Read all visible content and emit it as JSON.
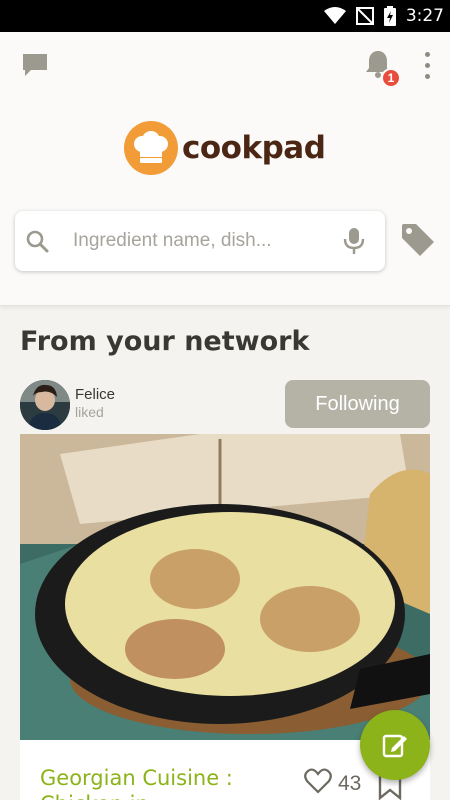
{
  "status_bar": {
    "time": "3:27"
  },
  "header": {
    "notification_count": "1",
    "logo_text": "cookpad",
    "search": {
      "placeholder": "Ingredient name, dish..."
    }
  },
  "feed": {
    "section_title": "From your network",
    "activity": {
      "user_name": "Felice",
      "action": "liked",
      "follow_label": "Following"
    },
    "card": {
      "title_line1": "Georgian Cuisine :",
      "title_line2": "Chicken in",
      "likes": "43"
    }
  },
  "colors": {
    "accent_green": "#8cb319",
    "brand_orange": "#f29c38",
    "brand_brown": "#4b2614",
    "badge_red": "#e84c3d"
  }
}
